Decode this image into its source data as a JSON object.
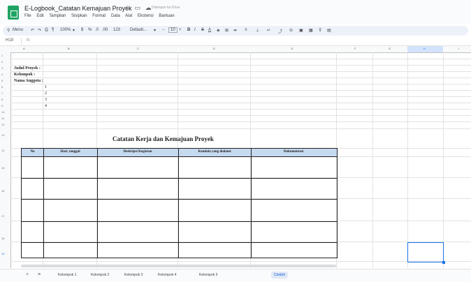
{
  "app": {
    "title": "E-Logbook_Catatan Kemajuan Proyek",
    "saved_status": "Disimpan ke Drive",
    "title_icons": [
      "star-icon",
      "folder-icon",
      "cloud-icon"
    ],
    "menu": [
      "File",
      "Edit",
      "Tampilan",
      "Sisipkan",
      "Format",
      "Data",
      "Alat",
      "Ekstensi",
      "Bantuan"
    ]
  },
  "toolbar": {
    "search": "Menu",
    "zoom": "100%",
    "currency": "$",
    "percent": "%",
    "dec_less": ".0",
    "dec_more": ".00",
    "number_fmt": "123",
    "font": "Default...",
    "font_size": "10"
  },
  "formula_bar": {
    "cell_ref": "H19",
    "fx": "fx"
  },
  "grid": {
    "columns": [
      "A",
      "B",
      "C",
      "D",
      "E",
      "F",
      "G",
      "H",
      "I"
    ],
    "selected_column": "H",
    "rows": [
      "1",
      "2",
      "3",
      "4",
      "5",
      "6",
      "7",
      "8",
      "9",
      "10",
      "11",
      "12",
      "13",
      "14",
      "15",
      "16",
      "17",
      "18",
      "19"
    ],
    "selected_row": "19"
  },
  "sheet": {
    "labels": [
      "Judul Proyek  :",
      "Kelompok  :",
      "Nama Anggota :"
    ],
    "members": [
      "1",
      "2",
      "3",
      "4"
    ],
    "table_title": "Catatan Kerja dan Kemajuan Proyek",
    "table_headers": [
      "No",
      "Hari, tanggal",
      "Deskripsi Kegiatan",
      "Kendala yang dialami",
      "Dokumentasi"
    ]
  },
  "tabs": {
    "sheets": [
      "Kelompok 1",
      "Kelompok 2",
      "Kelompok 3",
      "Kelompok 4",
      "Kelompok 5",
      "Contoh"
    ],
    "active": "Contoh",
    "add_icon": "plus-icon",
    "list_icon": "list-icon"
  },
  "colors": {
    "table_header": "#c5d9ef",
    "selection": "#1a73e8",
    "logo": "#1fa463"
  }
}
